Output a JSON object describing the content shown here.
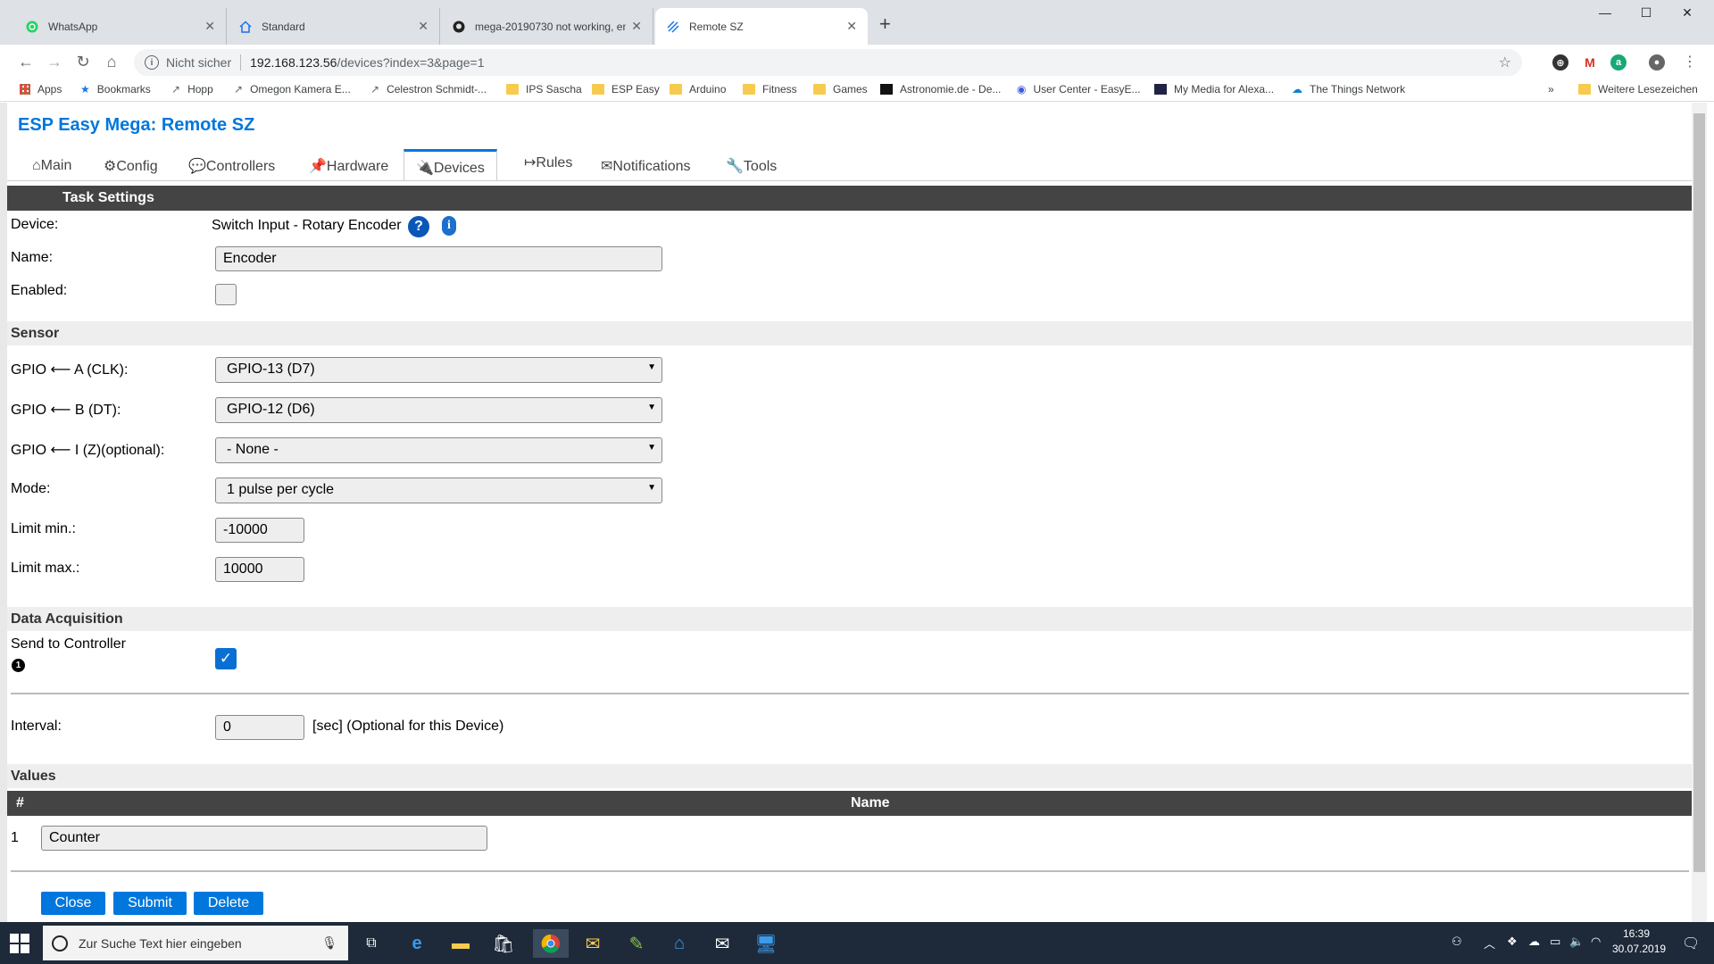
{
  "browser": {
    "tabs": [
      {
        "title": "WhatsApp",
        "icon": "whatsapp-icon"
      },
      {
        "title": "Standard",
        "icon": "home-icon"
      },
      {
        "title": "mega-20190730 not working, en",
        "icon": "github-icon"
      },
      {
        "title": "Remote SZ",
        "icon": "espeasy-icon"
      }
    ],
    "security_label": "Nicht sicher",
    "url_host": "192.168.123.56",
    "url_path": "/devices?index=3&page=1",
    "bookmarks": [
      {
        "label": "Apps"
      },
      {
        "label": "Bookmarks"
      },
      {
        "label": "Hopp"
      },
      {
        "label": "Omegon Kamera E..."
      },
      {
        "label": "Celestron Schmidt-..."
      },
      {
        "label": "IPS Sascha"
      },
      {
        "label": "ESP Easy"
      },
      {
        "label": "Arduino"
      },
      {
        "label": "Fitness"
      },
      {
        "label": "Games"
      },
      {
        "label": "Astronomie.de - De..."
      },
      {
        "label": "User Center - EasyE..."
      },
      {
        "label": "My Media for Alexa..."
      },
      {
        "label": "The Things Network"
      }
    ],
    "bookmarks_overflow": "»",
    "other_bookmarks": "Weitere Lesezeichen"
  },
  "app": {
    "title": "ESP Easy Mega: Remote SZ",
    "menu": [
      {
        "label": "⌂Main"
      },
      {
        "label": "⚙Config"
      },
      {
        "label": "💬Controllers"
      },
      {
        "label": "📌Hardware"
      },
      {
        "label": "🔌Devices"
      },
      {
        "label": "↦Rules"
      },
      {
        "label": "✉Notifications"
      },
      {
        "label": "🔧Tools"
      }
    ]
  },
  "form": {
    "header": "Task Settings",
    "device_label": "Device:",
    "device_value": "Switch Input - Rotary Encoder",
    "help_glyph": "?",
    "info_glyph": "i",
    "name_label": "Name:",
    "name_value": "Encoder",
    "enabled_label": "Enabled:",
    "sensor_section": "Sensor",
    "gpio_a_label": "GPIO ⟵ A (CLK):",
    "gpio_a_value": "GPIO-13 (D7)",
    "gpio_b_label": "GPIO ⟵ B (DT):",
    "gpio_b_value": "GPIO-12 (D6)",
    "gpio_i_label": "GPIO ⟵ I (Z)(optional):",
    "gpio_i_value": "- None -",
    "mode_label": "Mode:",
    "mode_value": "1 pulse per cycle",
    "limit_min_label": "Limit min.:",
    "limit_min_value": "-10000",
    "limit_max_label": "Limit max.:",
    "limit_max_value": "10000",
    "data_section": "Data Acquisition",
    "send_label": "Send to Controller",
    "send_marker": "1",
    "interval_label": "Interval:",
    "interval_value": "0",
    "interval_suffix": "[sec] (Optional for this Device)",
    "values_section": "Values",
    "values_col_num": "#",
    "values_col_name": "Name",
    "values_rows": [
      {
        "num": "1",
        "name": "Counter"
      }
    ],
    "close_button": "Close",
    "submit_button": "Submit",
    "delete_button": "Delete"
  },
  "taskbar": {
    "search_placeholder": "Zur Suche Text hier eingeben",
    "time": "16:39",
    "date": "30.07.2019"
  },
  "colors": {
    "accent": "#0077dd",
    "header_bar": "#444444",
    "section_bg": "#eeeeee"
  }
}
